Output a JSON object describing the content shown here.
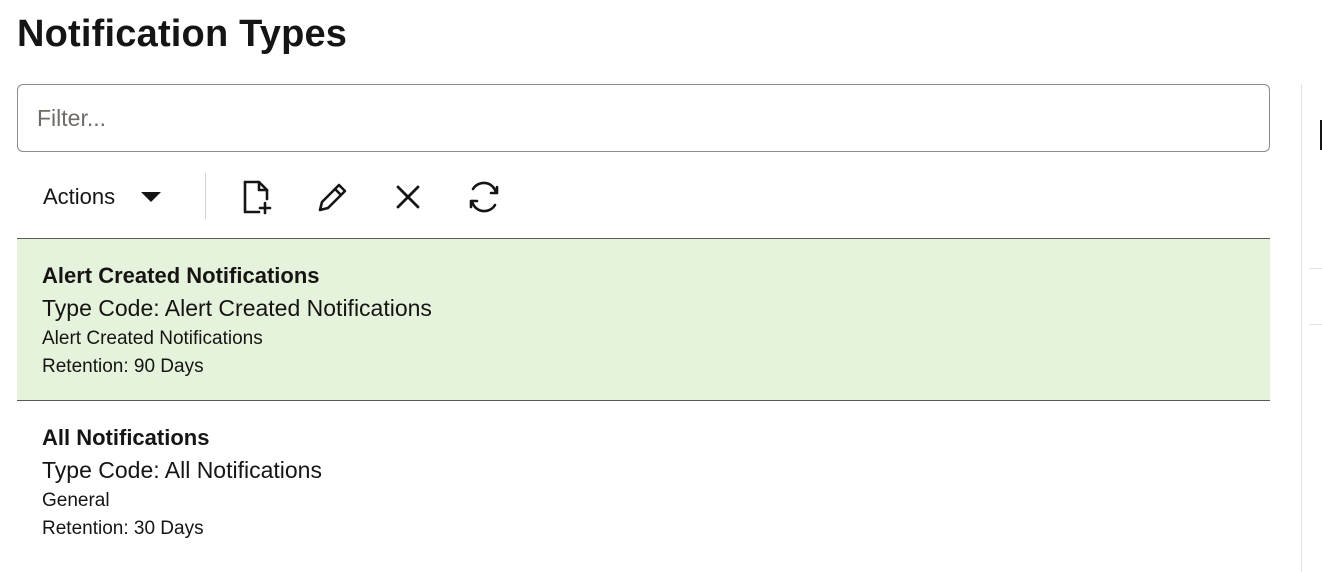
{
  "page": {
    "title": "Notification Types"
  },
  "filter": {
    "placeholder": "Filter...",
    "value": ""
  },
  "toolbar": {
    "actions_label": "Actions",
    "buttons": [
      {
        "name": "create",
        "icon": "new-document-icon"
      },
      {
        "name": "edit",
        "icon": "pencil-icon"
      },
      {
        "name": "delete",
        "icon": "close-icon"
      },
      {
        "name": "refresh",
        "icon": "refresh-icon"
      }
    ]
  },
  "items": [
    {
      "name": "Alert Created Notifications",
      "type_code": "Type Code: Alert Created Notifications",
      "description": "Alert Created Notifications",
      "retention": "Retention: 90 Days",
      "selected": true
    },
    {
      "name": "All Notifications",
      "type_code": "Type Code: All Notifications",
      "description": "General",
      "retention": "Retention: 30 Days",
      "selected": false
    }
  ],
  "colors": {
    "selected_row": "#e5f2dc",
    "text": "#161513",
    "border": "#8f8b87"
  }
}
